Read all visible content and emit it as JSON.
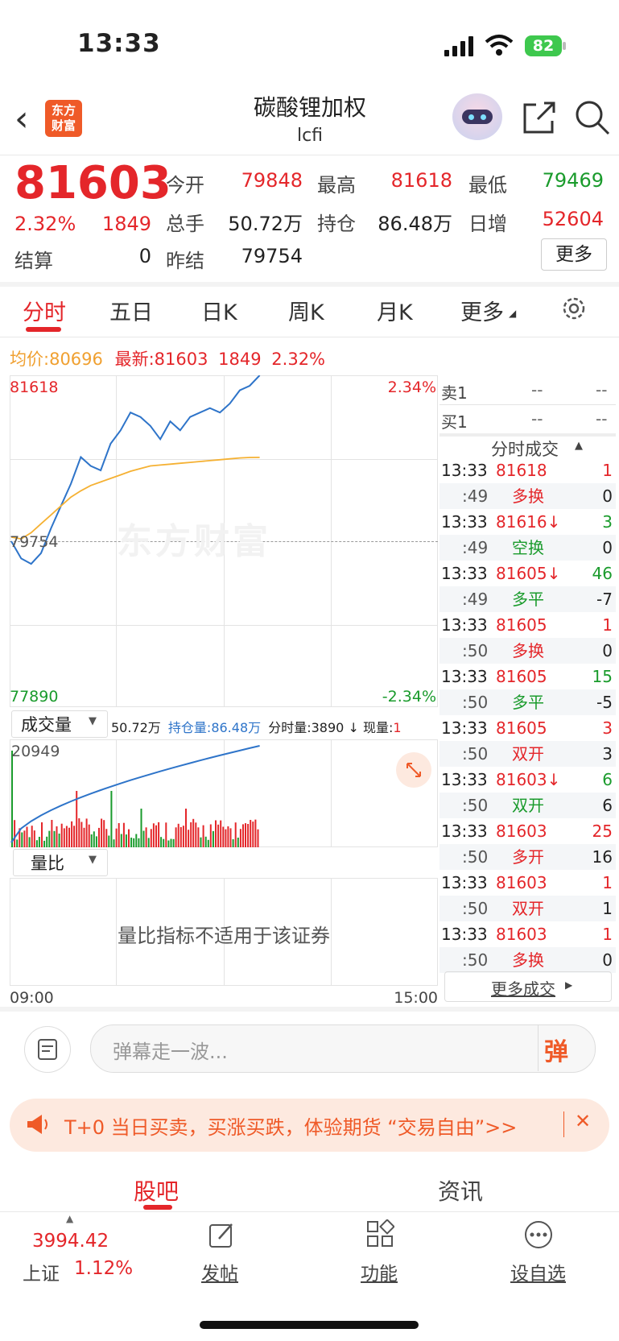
{
  "status_bar": {
    "time": "13:33",
    "battery": "82"
  },
  "header": {
    "title": "碳酸锂加权",
    "subtitle": "lcfi",
    "logo_text_1": "东方",
    "logo_text_2": "财富"
  },
  "quote": {
    "price": "81603",
    "change_pct": "2.32%",
    "change": "1849",
    "settle_label": "结算",
    "settle": "0",
    "open_label": "今开",
    "open": "79848",
    "high_label": "最高",
    "high": "81618",
    "low_label": "最低",
    "low": "79469",
    "volume_label": "总手",
    "volume": "50.72万",
    "oi_label": "持仓",
    "oi": "86.48万",
    "daily_inc_label": "日增",
    "daily_inc": "52604",
    "prev_settle_label": "昨结",
    "prev_settle": "79754",
    "more_label": "更多"
  },
  "tabs": [
    "分时",
    "五日",
    "日K",
    "周K",
    "月K",
    "更多"
  ],
  "summary": {
    "avg_label": "均价:",
    "avg": "80696",
    "latest_label": "最新:",
    "latest": "81603",
    "change": "1849",
    "pct": "2.32%"
  },
  "chart": {
    "top_price": "81618",
    "top_pct": "2.34%",
    "mid_price": "79754",
    "bottom_price": "77890",
    "bottom_pct": "-2.34%",
    "watermark": "东方财富",
    "time_start": "09:00",
    "time_end": "15:00",
    "indicator_select": "成交量",
    "vol_info": "50.72万",
    "oi_info_label": "持仓量:",
    "oi_info": "86.48万",
    "tick_vol_label": "分时量:",
    "tick_vol": "3890",
    "now_vol_label": "现量:",
    "now_vol": "1",
    "vol_max": "20949",
    "ratio_select": "量比",
    "ratio_msg": "量比指标不适用于该证券"
  },
  "chart_data": {
    "type": "line",
    "x_range": [
      "09:00",
      "15:00"
    ],
    "ylim": [
      77890,
      81618
    ],
    "series": [
      {
        "name": "最新",
        "values": [
          79754,
          79560,
          79500,
          79620,
          79900,
          80150,
          80400,
          80700,
          80600,
          80550,
          80850,
          81000,
          81200,
          81150,
          81050,
          80900,
          81100,
          81000,
          81150,
          81200,
          81250,
          81200,
          81300,
          81450,
          81500,
          81618
        ]
      },
      {
        "name": "均价",
        "values": [
          79800,
          79780,
          79850,
          79950,
          80050,
          80150,
          80250,
          80320,
          80380,
          80420,
          80460,
          80500,
          80540,
          80570,
          80600,
          80610,
          80620,
          80630,
          80640,
          80650,
          80660,
          80670,
          80680,
          80690,
          80695,
          80696
        ]
      }
    ]
  },
  "orderbook": {
    "sell1_label": "卖1",
    "sell1_price": "--",
    "sell1_vol": "--",
    "buy1_label": "买1",
    "buy1_price": "--",
    "buy1_vol": "--"
  },
  "trades_title": "分时成交",
  "trades": [
    {
      "t": "13:33",
      "p": "81618",
      "pc": "red",
      "v": "1",
      "vc": "red",
      "t2": ":49",
      "k": "多换",
      "kc": "red",
      "n": "0",
      "nc": "gray"
    },
    {
      "t": "13:33",
      "p": "81616↓",
      "pc": "red",
      "v": "3",
      "vc": "green",
      "t2": ":49",
      "k": "空换",
      "kc": "green",
      "n": "0",
      "nc": "gray"
    },
    {
      "t": "13:33",
      "p": "81605↓",
      "pc": "red",
      "v": "46",
      "vc": "green",
      "t2": ":49",
      "k": "多平",
      "kc": "green",
      "n": "-7",
      "nc": "gray"
    },
    {
      "t": "13:33",
      "p": "81605",
      "pc": "red",
      "v": "1",
      "vc": "red",
      "t2": ":50",
      "k": "多换",
      "kc": "red",
      "n": "0",
      "nc": "gray"
    },
    {
      "t": "13:33",
      "p": "81605",
      "pc": "red",
      "v": "15",
      "vc": "green",
      "t2": ":50",
      "k": "多平",
      "kc": "green",
      "n": "-5",
      "nc": "gray"
    },
    {
      "t": "13:33",
      "p": "81605",
      "pc": "red",
      "v": "3",
      "vc": "red",
      "t2": ":50",
      "k": "双开",
      "kc": "red",
      "n": "3",
      "nc": "gray"
    },
    {
      "t": "13:33",
      "p": "81603↓",
      "pc": "red",
      "v": "6",
      "vc": "green",
      "t2": ":50",
      "k": "双开",
      "kc": "green",
      "n": "6",
      "nc": "gray"
    },
    {
      "t": "13:33",
      "p": "81603",
      "pc": "red",
      "v": "25",
      "vc": "red",
      "t2": ":50",
      "k": "多开",
      "kc": "red",
      "n": "16",
      "nc": "gray"
    },
    {
      "t": "13:33",
      "p": "81603",
      "pc": "red",
      "v": "1",
      "vc": "red",
      "t2": ":50",
      "k": "双开",
      "kc": "red",
      "n": "1",
      "nc": "gray"
    },
    {
      "t": "13:33",
      "p": "81603",
      "pc": "red",
      "v": "1",
      "vc": "red",
      "t2": ":50",
      "k": "多换",
      "kc": "red",
      "n": "0",
      "nc": "gray"
    }
  ],
  "more_trades": "更多成交",
  "comment": {
    "placeholder": "弹幕走一波...",
    "danmu_btn": "弹"
  },
  "promo": {
    "text": "T+0 当日买卖，买涨买跌，体验期货 “交易自由”>>",
    "close": "✕"
  },
  "bottom_tabs": [
    "股吧",
    "资讯"
  ],
  "bottom_nav": {
    "index_value": "3994.42",
    "index_name": "上证",
    "index_pct": "1.12%",
    "post": "发帖",
    "func": "功能",
    "watch": "设自选"
  }
}
